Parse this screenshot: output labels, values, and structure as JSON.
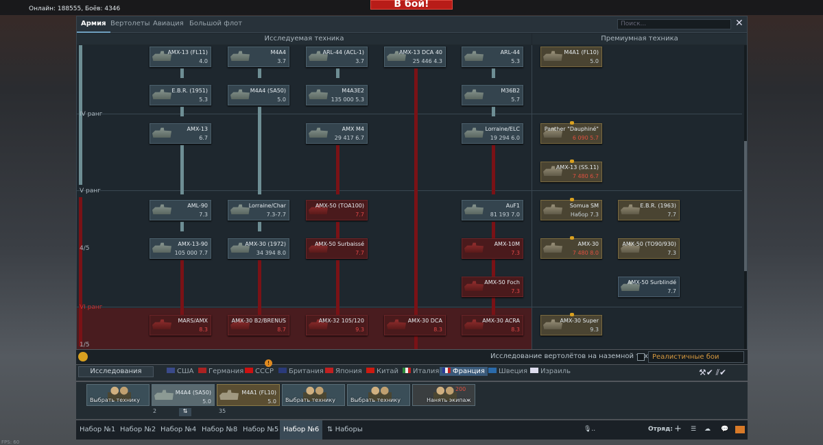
{
  "topbar": {
    "online": "Онлайн: 188555, Боёв: 4346",
    "battle": "В бой!"
  },
  "fps": "FPS: 60",
  "tabs": [
    "Армия",
    "Вертолеты",
    "Авиация",
    "Большой флот"
  ],
  "search_placeholder": "Поиск...",
  "headers": {
    "research": "Исследуемая техника",
    "premium": "Премиумная техника"
  },
  "ranks": {
    "r4": "IV ранг",
    "r5": "V ранг",
    "r6": "VI ранг",
    "c5": "4/5",
    "c6": "1/5"
  },
  "vehicles": [
    {
      "n": "AMX-13 (FL11)",
      "b": "4.0"
    },
    {
      "n": "M4A4",
      "b": "3.7"
    },
    {
      "n": "ARL-44 (ACL-1)",
      "b": "3.7"
    },
    {
      "n": "AMX-13 DCA 40",
      "b": "25 446 4.3"
    },
    {
      "n": "ARL-44",
      "b": "5.3"
    },
    {
      "n": "E.B.R. (1951)",
      "b": "5.3"
    },
    {
      "n": "M4A4 (SA50)",
      "b": "5.0"
    },
    {
      "n": "M4A3E2",
      "b": "135 000 5.3"
    },
    {
      "n": "M36B2",
      "b": "5.7"
    },
    {
      "n": "AMX-13",
      "b": "6.7"
    },
    {
      "n": "AMX M4",
      "b": "29 417 6.7"
    },
    {
      "n": "Lorraine/ELC",
      "b": "19 294 6.0"
    },
    {
      "n": "AML-90",
      "b": "7.3"
    },
    {
      "n": "Lorraine/Char",
      "b": "7.3-7.7"
    },
    {
      "n": "AMX-50 (TOA100)",
      "b": "7.7"
    },
    {
      "n": "AuF1",
      "b": "81 193 7.0"
    },
    {
      "n": "AMX-13-90",
      "b": "105 000 7.7"
    },
    {
      "n": "AMX-30 (1972)",
      "b": "34 394 8.0"
    },
    {
      "n": "AMX-50 Surbaissé",
      "b": "7.7"
    },
    {
      "n": "AMX-10M",
      "b": "7.3"
    },
    {
      "n": "AMX-50 Foch",
      "b": "7.3"
    },
    {
      "n": "MARS/AMX",
      "b": "8.3"
    },
    {
      "n": "AMX-30 B2/BRENUS",
      "b": "8.7"
    },
    {
      "n": "AMX-32 105/120",
      "b": "9.3"
    },
    {
      "n": "AMX-30 DCA",
      "b": "8.3"
    },
    {
      "n": "AMX-30 ACRA",
      "b": "8.3"
    },
    {
      "n": "M4A1 (FL10)",
      "b": "5.0"
    },
    {
      "n": "Panther \"Dauphiné\"",
      "b": "6 090 5.7"
    },
    {
      "n": "AMX-13 (SS.11)",
      "b": "7 480 6.7"
    },
    {
      "n": "Somua SM",
      "b": "Набор 7.3"
    },
    {
      "n": "E.B.R. (1963)",
      "b": "7.7"
    },
    {
      "n": "AMX-30",
      "b": "7 480 8.0"
    },
    {
      "n": "AMX-50 (TO90/930)",
      "b": "7.3"
    },
    {
      "n": "AMX-50 Surblindé",
      "b": "7.7"
    },
    {
      "n": "AMX-30 Super",
      "b": "9.3"
    }
  ],
  "heli_label": "Исследование вертолётов на наземной технике",
  "mode": "Реалистичные бои",
  "research_btn": "Исследования",
  "nations": [
    "США",
    "Германия",
    "СССР",
    "Британия",
    "Япония",
    "Китай",
    "Италия",
    "Франция",
    "Швеция",
    "Израиль"
  ],
  "ussr_badge": "!",
  "slots": [
    {
      "lbl": "Выбрать технику"
    },
    {
      "nm": "M4A4 (SA50)",
      "br": "5.0",
      "under": "2"
    },
    {
      "nm": "M4A1 (FL10)",
      "br": "5.0",
      "under": "35"
    },
    {
      "lbl": "Выбрать технику"
    },
    {
      "lbl": "Выбрать технику"
    },
    {
      "lbl": "Нанять экипаж",
      "cost": "200"
    }
  ],
  "presets": [
    "Набор №1",
    "Набор №2",
    "Набор №4",
    "Набор №8",
    "Набор №5",
    "Набор №6",
    "Наборы"
  ],
  "squad": "Отряд:"
}
